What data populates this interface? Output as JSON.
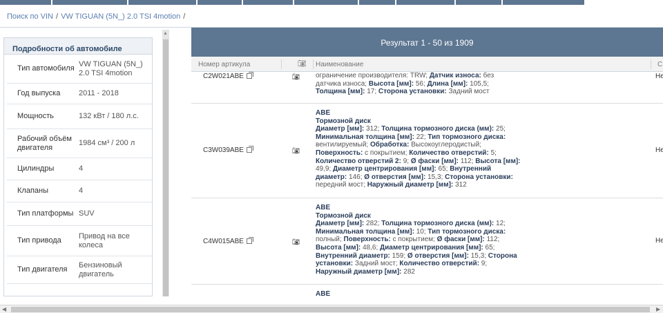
{
  "breadcrumb": {
    "items": [
      "Поиск по VIN",
      "VW  TIGUAN (5N_)  2.0 TSI 4motion"
    ],
    "separator": "/"
  },
  "details": {
    "title": "Подробности об автомобиле",
    "rows": [
      {
        "key": "Тип автомобиля",
        "value": "VW  TIGUAN (5N_) 2.0 TSI 4motion"
      },
      {
        "key": "Год выпуска",
        "value": "2011 - 2018"
      },
      {
        "key": "Мощность",
        "value": "132 кВт / 180 л.с."
      },
      {
        "key": "Рабочий объём двигателя",
        "value": "1984 см³ / 200 л"
      },
      {
        "key": "Цилиндры",
        "value": "4"
      },
      {
        "key": "Клапаны",
        "value": "4"
      },
      {
        "key": "Тип платформы",
        "value": "SUV"
      },
      {
        "key": "Тип привода",
        "value": "Привод на все колеса"
      },
      {
        "key": "Тип двигателя",
        "value": "Бензиновый двигатель"
      }
    ]
  },
  "results": {
    "header": "Результат 1 - 50 из 1909",
    "columns": {
      "article": "Номер артикула",
      "photo_icon": "camera-icon",
      "name": "Наименование",
      "cut": "С"
    },
    "rows": [
      {
        "article": "C2W021ABE",
        "html_lines": [
          "<span class='v'>ограничение производителя: TRW;</span> <b>Датчик износа:</b> <span class='v'>без</span>",
          "<span class='v'>датчика износа;</span> <b>Высота [мм]:</b> <span class='v'>56;</span> <b>Длина [мм]:</b> <span class='v'>105,5;</span>",
          "<b>Толщина [мм]:</b> <span class='v'>17;</span> <b>Сторона установки:</b> <span class='v'>Задний мост</span>"
        ],
        "cut": "Не"
      },
      {
        "article": "C3W039ABE",
        "brand": "ABE",
        "type": "Тормозной диск",
        "cut": "Не"
      },
      {
        "article": "C4W015ABE",
        "brand": "ABE",
        "type": "Тормозной диск",
        "cut": "Не"
      }
    ],
    "last_brand": "ABE"
  },
  "colors": {
    "accent": "#5d7691",
    "link": "#5b7fb0"
  }
}
